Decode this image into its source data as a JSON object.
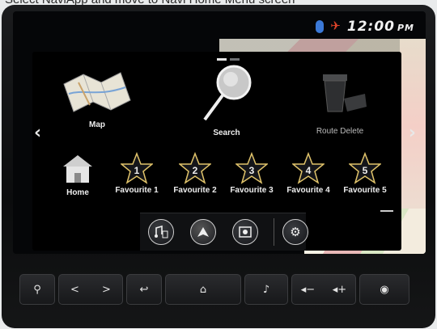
{
  "caption": "Select NaviApp and move to Navi Home Menu screen",
  "status": {
    "time": "12:00",
    "ampm": "PM"
  },
  "menu": {
    "tiles": [
      {
        "id": "map",
        "label": "Map"
      },
      {
        "id": "search",
        "label": "Search"
      },
      {
        "id": "route_delete",
        "label": "Route Delete"
      },
      {
        "id": "home",
        "label": "Home"
      }
    ],
    "favourites": [
      {
        "number": "1",
        "label": "Favourite 1"
      },
      {
        "number": "2",
        "label": "Favourite 2"
      },
      {
        "number": "3",
        "label": "Favourite 3"
      },
      {
        "number": "4",
        "label": "Favourite 4"
      },
      {
        "number": "5",
        "label": "Favourite 5"
      }
    ]
  },
  "dock": [
    "audio-app-icon",
    "navigation-app-icon",
    "media-app-icon",
    "settings-icon"
  ],
  "hardware": [
    "location-icon",
    "prev-next-icons",
    "back-icon",
    "home-icon",
    "media-power-icon",
    "volume-down-icon",
    "volume-up-icon",
    "voice-icon"
  ]
}
